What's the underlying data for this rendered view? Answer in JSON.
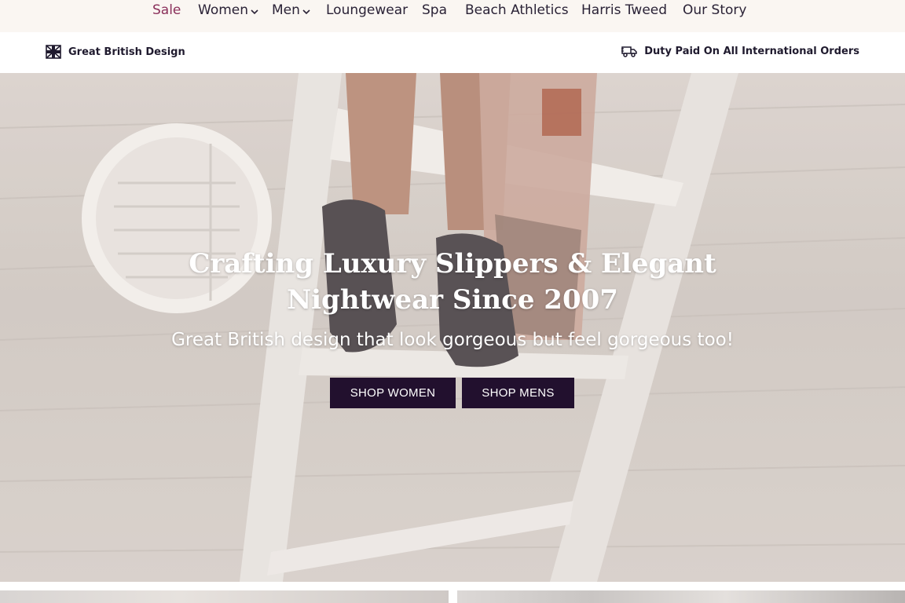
{
  "nav": {
    "items": [
      {
        "label": "Sale"
      },
      {
        "label": "Women"
      },
      {
        "label": "Men"
      },
      {
        "label": "Loungewear"
      },
      {
        "label": "Spa"
      },
      {
        "label": "Beach Athletics"
      },
      {
        "label": "Harris Tweed"
      },
      {
        "label": "Our Story"
      }
    ]
  },
  "usp": {
    "left_text": "Great British Design",
    "right_text": "Duty Paid On All International Orders"
  },
  "hero": {
    "title_line1": "Crafting Luxury Slippers & Elegant",
    "title_line2": "Nightwear Since 2007",
    "subtitle": "Great British design that look gorgeous but feel gorgeous too!",
    "button_women": "SHOP WOMEN",
    "button_men": "SHOP MENS"
  },
  "colors": {
    "accent_sale": "#8a2f5a",
    "button_bg": "#22102e",
    "nav_bg": "#faf6f2"
  },
  "icons": {
    "usp_left": "union-jack-flag-icon",
    "usp_right": "delivery-truck-icon",
    "nav_dropdown": "chevron-down-icon"
  }
}
